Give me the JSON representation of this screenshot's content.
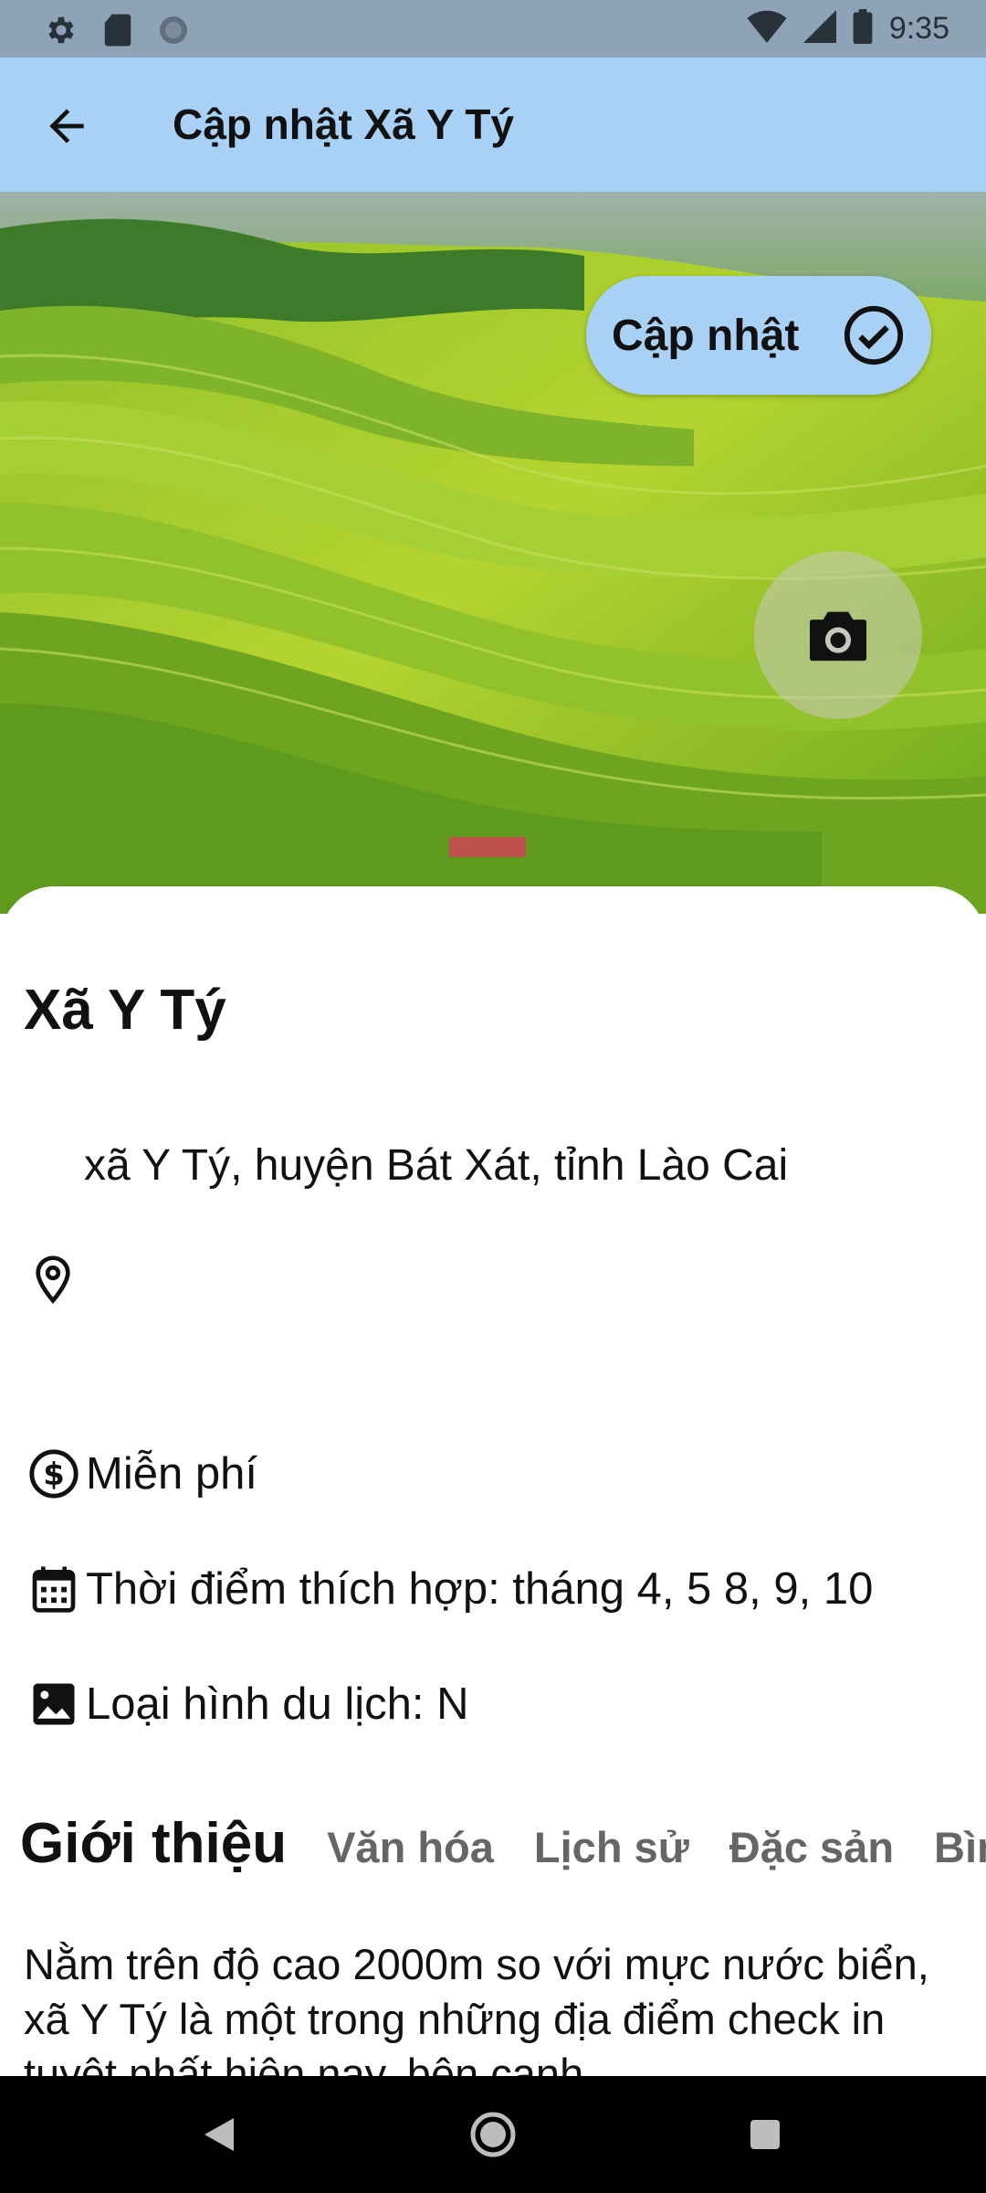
{
  "status_bar": {
    "time": "9:35",
    "icons_left": [
      "gear-icon",
      "sd-card-icon",
      "sync-icon"
    ],
    "icons_right": [
      "wifi-icon",
      "signal-icon",
      "battery-icon"
    ]
  },
  "app_bar": {
    "title": "Cập nhật Xã Y Tý"
  },
  "hero": {
    "update_button_label": "Cập nhật"
  },
  "place": {
    "name": "Xã Y Tý",
    "address": "xã Y Tý, huyện Bát Xát, tỉnh Lào Cai",
    "price": "Miễn phí",
    "best_time": "Thời điểm thích hợp: tháng 4, 5 8, 9, 10",
    "tourism_type": "Loại hình du lịch: N"
  },
  "tabs": [
    {
      "label": "Giới thiệu",
      "active": true
    },
    {
      "label": "Văn hóa",
      "active": false
    },
    {
      "label": "Lịch sử",
      "active": false
    },
    {
      "label": "Đặc sản",
      "active": false
    },
    {
      "label": "Bìn",
      "active": false
    }
  ],
  "description": "Nằm trên độ cao 2000m so với mực nước biển, xã Y Tý là một trong những địa điểm check in tuyệt nhất hiện nay, bên cạnh",
  "colors": {
    "app_bar": "#a9d1f5",
    "status_bar": "#8ea3b8",
    "nav_bar": "#000000"
  }
}
